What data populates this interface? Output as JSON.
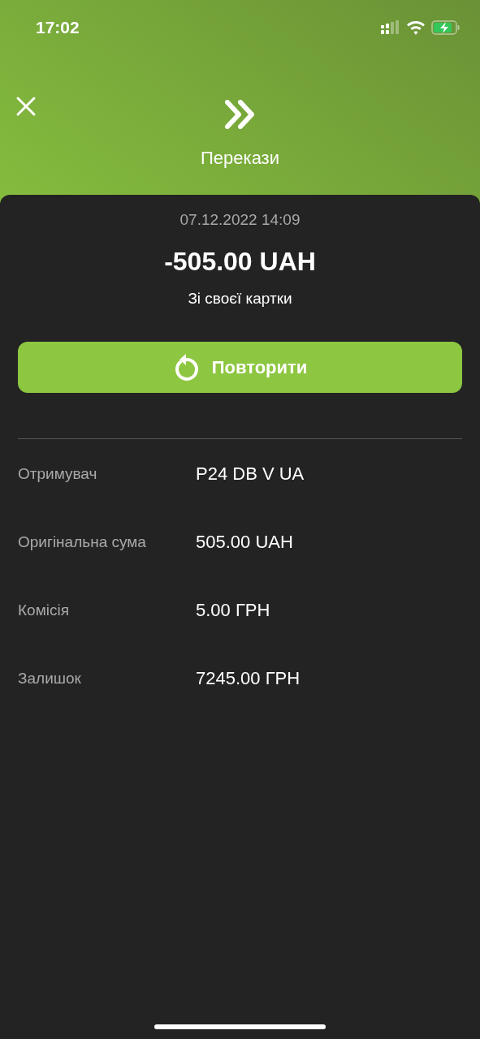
{
  "status_bar": {
    "time": "17:02"
  },
  "header": {
    "title": "Перекази"
  },
  "transaction": {
    "datetime": "07.12.2022 14:09",
    "amount": "-505.00 UAH",
    "description": "Зі своєї картки"
  },
  "repeat_button": {
    "label": "Повторити"
  },
  "details": [
    {
      "label": "Отримувач",
      "value": "P24 DB V UA"
    },
    {
      "label": "Оригінальна сума",
      "value": "505.00 UAH"
    },
    {
      "label": "Комісія",
      "value": "5.00 ГРН"
    },
    {
      "label": "Залишок",
      "value": "7245.00 ГРН"
    }
  ]
}
